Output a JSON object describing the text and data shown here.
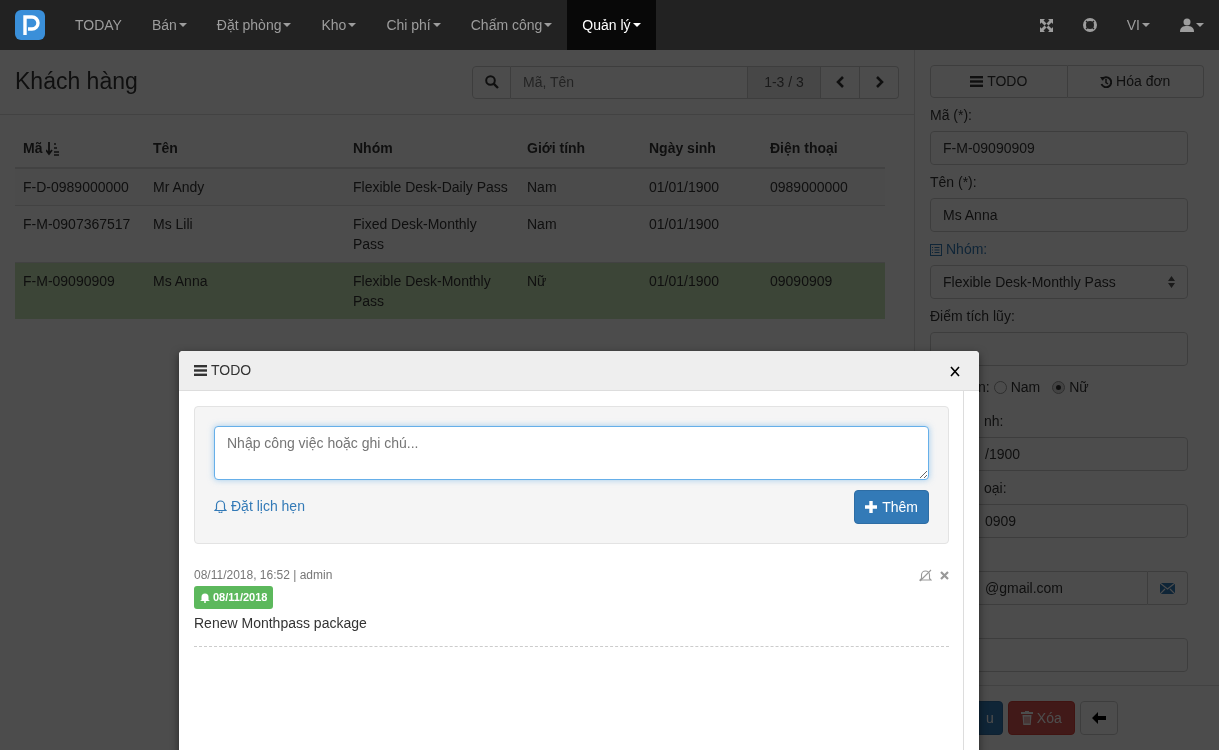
{
  "navbar": {
    "items": [
      {
        "label": "TODAY",
        "dropdown": false,
        "selected": false
      },
      {
        "label": "Bán",
        "dropdown": true,
        "selected": false
      },
      {
        "label": "Đặt phòng",
        "dropdown": true,
        "selected": false
      },
      {
        "label": "Kho",
        "dropdown": true,
        "selected": false
      },
      {
        "label": "Chi phí",
        "dropdown": true,
        "selected": false
      },
      {
        "label": "Chấm công",
        "dropdown": true,
        "selected": false
      },
      {
        "label": "Quản lý",
        "dropdown": true,
        "selected": true
      }
    ],
    "language": "VI"
  },
  "page": {
    "title": "Khách hàng",
    "search": {
      "placeholder": "Mã, Tên"
    },
    "pager": "1-3 / 3"
  },
  "table": {
    "columns": [
      {
        "label": "Mã",
        "sorted": true
      },
      {
        "label": "Tên",
        "sorted": false
      },
      {
        "label": "Nhóm",
        "sorted": false
      },
      {
        "label": "Giới tính",
        "sorted": false
      },
      {
        "label": "Ngày sinh",
        "sorted": false
      },
      {
        "label": "Điện thoại",
        "sorted": false
      }
    ],
    "rows": [
      {
        "cells": [
          "F-D-0989000000",
          "Mr Andy",
          "Flexible Desk-Daily Pass",
          "Nam",
          "01/01/1900",
          "0989000000"
        ],
        "selected": false
      },
      {
        "cells": [
          "F-M-0907367517",
          "Ms Lili",
          "Fixed Desk-Monthly Pass",
          "Nam",
          "01/01/1900",
          ""
        ],
        "selected": false
      },
      {
        "cells": [
          "F-M-09090909",
          "Ms Anna",
          "Flexible Desk-Monthly Pass",
          "Nữ",
          "01/01/1900",
          "09090909"
        ],
        "selected": true
      }
    ]
  },
  "panel": {
    "tabs": [
      {
        "label": "TODO",
        "kind": "todo"
      },
      {
        "label": "Hóa đơn",
        "kind": "history"
      }
    ],
    "fields": [
      {
        "kind": "text",
        "label": "Mã (*):",
        "value": "F-M-09090909"
      },
      {
        "kind": "text",
        "label": "Tên (*):",
        "value": "Ms Anna"
      },
      {
        "kind": "select",
        "label": "Nhóm:",
        "value": "Flexible Desk-Monthly Pass"
      },
      {
        "kind": "text",
        "label": "Điểm tích lũy:"
      },
      {
        "kind": "radio",
        "label": "n:",
        "options": [
          {
            "label": "Nam",
            "selected": false
          },
          {
            "label": "Nữ",
            "selected": true
          }
        ]
      },
      {
        "kind": "text",
        "label": "nh:",
        "value": "/1900",
        "covered": true
      },
      {
        "kind": "text",
        "label": "oại:",
        "value": "0909",
        "covered": true
      },
      {
        "kind": "email",
        "value": "@gmail.com",
        "covered": true
      },
      {
        "kind": "text"
      }
    ],
    "buttons": [
      {
        "kind": "save",
        "label": "u"
      },
      {
        "kind": "delete",
        "label": "Xóa"
      },
      {
        "kind": "back"
      }
    ]
  },
  "modal": {
    "title": "TODO",
    "textarea": {
      "placeholder": "Nhập công việc hoặc ghi chú..."
    },
    "reminder_link": "Đặt lịch hẹn",
    "add_button": "Thêm",
    "entries": [
      {
        "meta": "08/11/2018, 16:52 | admin",
        "reminder": "08/11/2018",
        "text": "Renew Monthpass package"
      }
    ]
  }
}
